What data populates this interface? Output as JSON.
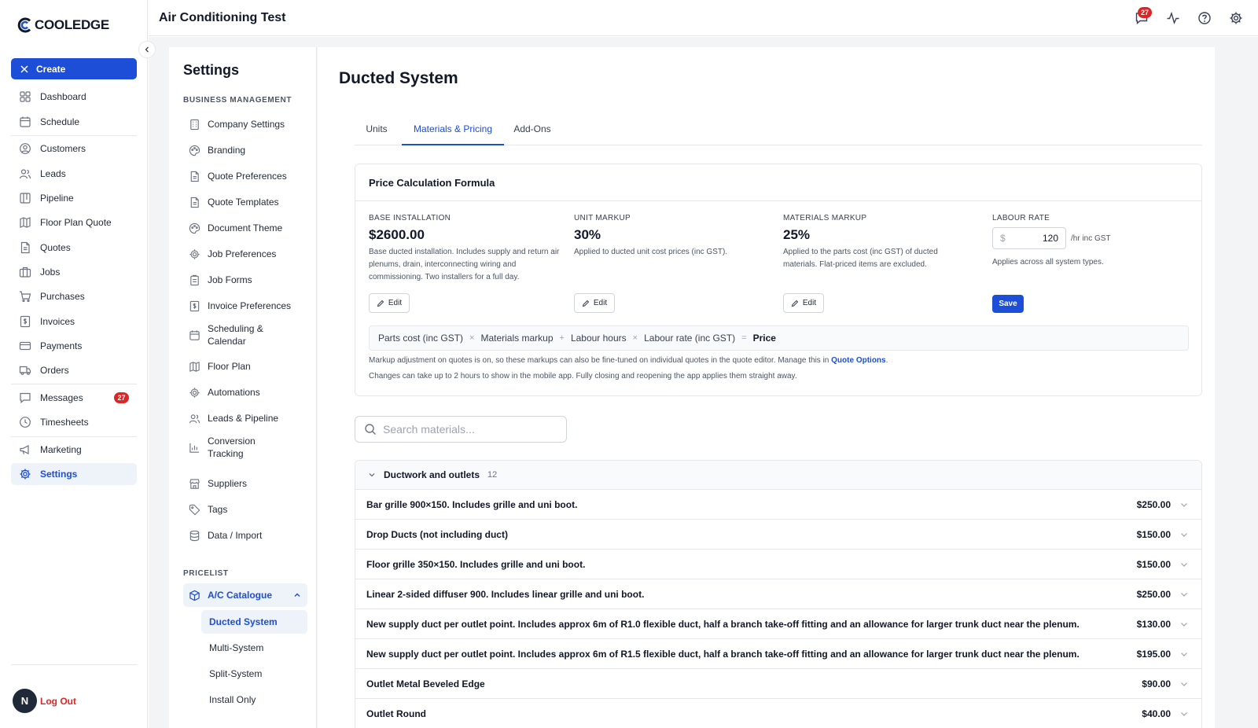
{
  "app": {
    "logo_text": "COOLEDGE",
    "title": "Air Conditioning Test",
    "notification_count": "27"
  },
  "leftnav": {
    "create_label": "Create",
    "items": [
      {
        "label": "Dashboard",
        "icon": "dashboard-icon"
      },
      {
        "label": "Schedule",
        "icon": "calendar-icon"
      },
      {
        "label": "Customers",
        "icon": "user-circle-icon"
      },
      {
        "label": "Leads",
        "icon": "users-icon"
      },
      {
        "label": "Pipeline",
        "icon": "pipeline-icon"
      },
      {
        "label": "Floor Plan Quote",
        "icon": "map-icon"
      },
      {
        "label": "Quotes",
        "icon": "document-icon"
      },
      {
        "label": "Jobs",
        "icon": "briefcase-icon"
      },
      {
        "label": "Purchases",
        "icon": "cart-icon"
      },
      {
        "label": "Invoices",
        "icon": "invoice-icon"
      },
      {
        "label": "Payments",
        "icon": "credit-card-icon"
      },
      {
        "label": "Orders",
        "icon": "truck-icon"
      },
      {
        "label": "Messages",
        "icon": "message-icon",
        "badge": "27"
      },
      {
        "label": "Timesheets",
        "icon": "clock-icon"
      },
      {
        "label": "Marketing",
        "icon": "megaphone-icon"
      },
      {
        "label": "Settings",
        "icon": "gear-icon"
      }
    ],
    "logout": {
      "avatar": "N",
      "label": "Log Out"
    }
  },
  "settings_nav": {
    "title": "Settings",
    "section_business": "BUSINESS MANAGEMENT",
    "business_items": [
      "Company Settings",
      "Branding",
      "Quote Preferences",
      "Quote Templates",
      "Document Theme",
      "Job Preferences",
      "Job Forms",
      "Invoice Preferences",
      "Scheduling & Calendar",
      "Floor Plan",
      "Automations",
      "Leads & Pipeline",
      "Conversion Tracking",
      "Suppliers",
      "Tags",
      "Data / Import"
    ],
    "section_pricelist": "PRICELIST",
    "catalogue_label": "A/C Catalogue",
    "catalogue_items": [
      "Ducted System",
      "Multi-System",
      "Split-System",
      "Install Only"
    ]
  },
  "main": {
    "title": "Ducted System",
    "tabs": [
      "Units",
      "Materials & Pricing",
      "Add-Ons"
    ],
    "active_tab": "Materials & Pricing",
    "pricing": {
      "heading": "Price Calculation Formula",
      "base": {
        "label": "BASE INSTALLATION",
        "value": "$2600.00",
        "desc": "Base ducted installation. Includes supply and return air plenums, drain, interconnecting wiring and commissioning. Two installers for a full day.",
        "edit": "Edit"
      },
      "unit": {
        "label": "UNIT MARKUP",
        "value": "30%",
        "desc": "Applied to ducted unit cost prices (inc GST).",
        "edit": "Edit"
      },
      "materials": {
        "label": "MATERIALS MARKUP",
        "value": "25%",
        "desc": "Applied to the parts cost (inc GST) of ducted materials. Flat-priced items are excluded.",
        "edit": "Edit"
      },
      "labour": {
        "label": "LABOUR RATE",
        "prefix": "$",
        "value": "120",
        "unit": "/hr inc GST",
        "desc": "Applies across all system types.",
        "save": "Save"
      },
      "formula": {
        "t1": "Parts cost (inc GST)",
        "op1": "×",
        "t2": "Materials markup",
        "op2": "+",
        "t3": "Labour hours",
        "op3": "×",
        "t4": "Labour rate (inc GST)",
        "op4": "=",
        "result": "Price"
      },
      "note1": "Markup adjustment on quotes is on, so these markups can also be fine-tuned on individual quotes in the quote editor. Manage this in",
      "note1_link": "Quote Options",
      "note1_end": ".",
      "note2": "Changes can take up to 2 hours to show in the mobile app. Fully closing and reopening the app applies them straight away."
    },
    "search_placeholder": "Search materials...",
    "group": {
      "name": "Ductwork and outlets",
      "count": "12",
      "rows": [
        {
          "name": "Bar grille 900×150. Includes grille and uni boot.",
          "price": "$250.00"
        },
        {
          "name": "Drop Ducts (not including duct)",
          "price": "$150.00"
        },
        {
          "name": "Floor grille 350×150. Includes grille and uni boot.",
          "price": "$150.00"
        },
        {
          "name": "Linear 2-sided diffuser 900. Includes linear grille and uni boot.",
          "price": "$250.00"
        },
        {
          "name": "New supply duct per outlet point. Includes approx 6m of R1.0 flexible duct, half a branch take-off fitting and an allowance for larger trunk duct near the plenum.",
          "price": "$130.00"
        },
        {
          "name": "New supply duct per outlet point. Includes approx 6m of R1.5 flexible duct, half a branch take-off fitting and an allowance for larger trunk duct near the plenum.",
          "price": "$195.00"
        },
        {
          "name": "Outlet Metal Beveled Edge",
          "price": "$90.00"
        },
        {
          "name": "Outlet Round",
          "price": "$40.00"
        }
      ]
    }
  },
  "colors": {
    "accent": "#1d4ed8",
    "badge": "#dc2626",
    "logout": "#dc2626"
  }
}
